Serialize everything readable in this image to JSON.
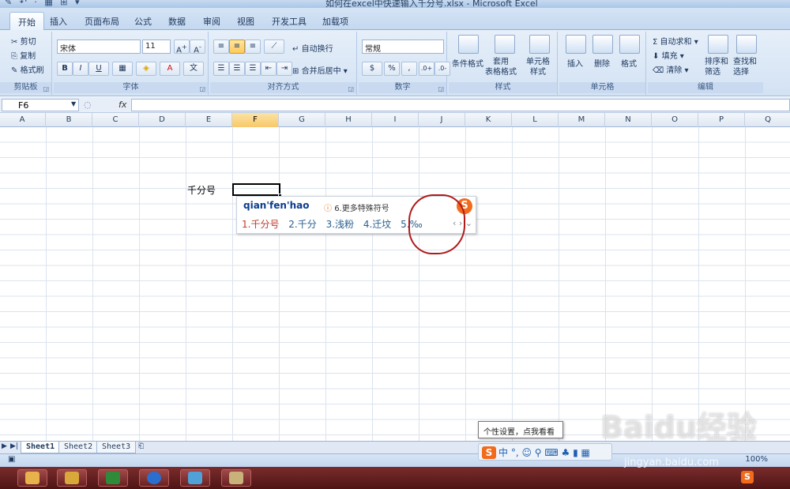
{
  "window": {
    "title": "如何在excel中快速输入千分号.xlsx - Microsoft Excel",
    "qat": "✎ ↶ · ▦ ⊞ ▾"
  },
  "tabs": [
    "开始",
    "插入",
    "页面布局",
    "公式",
    "数据",
    "审阅",
    "视图",
    "开发工具",
    "加载项"
  ],
  "ribbon": {
    "clipboard": {
      "cut": "剪切",
      "copy": "复制",
      "format_painter": "格式刷",
      "label": "剪贴板"
    },
    "font": {
      "name": "宋体",
      "size": "11",
      "bold": "B",
      "italic": "I",
      "underline": "U",
      "label": "字体"
    },
    "alignment": {
      "wrap": "自动换行",
      "merge": "合并后居中",
      "label": "对齐方式"
    },
    "number": {
      "format": "常规",
      "percent": "%",
      "comma": ",",
      "label": "数字"
    },
    "styles": {
      "conditional": "条件格式",
      "table_format": "套用\n表格格式",
      "cell_style": "单元格\n样式",
      "label": "样式"
    },
    "cells": {
      "insert": "插入",
      "delete": "删除",
      "format": "格式",
      "label": "单元格"
    },
    "editing": {
      "autosum": "自动求和",
      "fill": "填充",
      "clear": "清除",
      "sort_filter": "排序和\n筛选",
      "find_select": "查找和\n选择",
      "label": "编辑"
    }
  },
  "formula_bar": {
    "name_box": "F6",
    "fx": "fx",
    "value": ""
  },
  "columns": [
    "A",
    "B",
    "C",
    "D",
    "E",
    "F",
    "G",
    "H",
    "I",
    "J",
    "K",
    "L",
    "M",
    "N",
    "O",
    "P",
    "Q"
  ],
  "selected_column": "F",
  "cells": {
    "E6": "千分号"
  },
  "ime_popup": {
    "pinyin": "qian'fen'hao",
    "more_symbols": "6.更多特殊符号",
    "candidates": [
      "1.千分号",
      "2.千分",
      "3.浅粉",
      "4.迁坟",
      "5.‰"
    ],
    "nav": "‹ › ⌄"
  },
  "tooltip": "个性设置，点我看看",
  "sheets": [
    "Sheet1",
    "Sheet2",
    "Sheet3"
  ],
  "active_sheet": "Sheet1",
  "ime_status": "中 °, ☺ ⚲ ⌨ ♣ ▮ ▦",
  "status": {
    "zoom": "100%"
  },
  "watermark": {
    "main": "Baidu经验",
    "url": "jingyan.baidu.com"
  }
}
